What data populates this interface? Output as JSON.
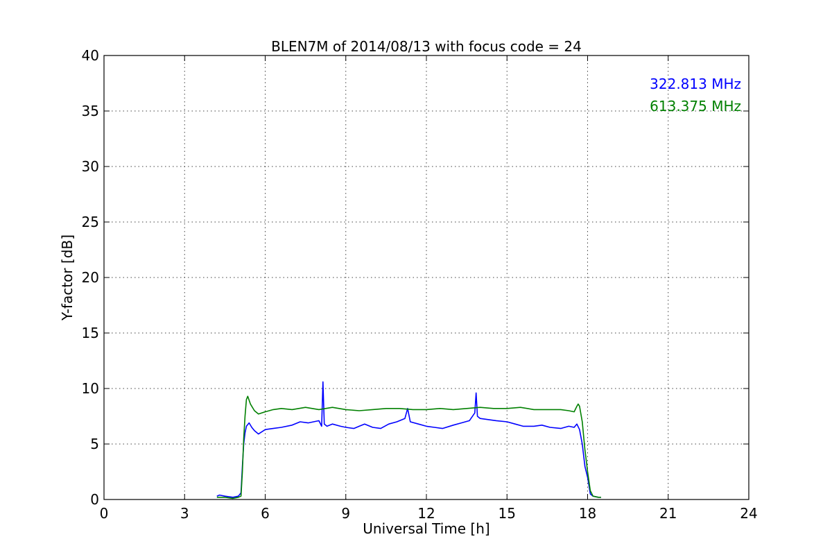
{
  "chart_data": {
    "type": "line",
    "title": "BLEN7M of 2014/08/13 with focus code = 24",
    "xlabel": "Universal Time [h]",
    "ylabel": "Y-factor [dB]",
    "xlim": [
      0,
      24
    ],
    "ylim": [
      0,
      40
    ],
    "xticks": [
      0,
      3,
      6,
      9,
      12,
      15,
      18,
      21,
      24
    ],
    "yticks": [
      0,
      5,
      10,
      15,
      20,
      25,
      30,
      35,
      40
    ],
    "grid": true,
    "legend_position": "top-right",
    "series": [
      {
        "name": "322.813 MHz",
        "color": "#0000ff",
        "x": [
          4.2,
          4.3,
          4.5,
          4.8,
          5.0,
          5.1,
          5.15,
          5.2,
          5.25,
          5.3,
          5.4,
          5.5,
          5.6,
          5.75,
          6.0,
          6.3,
          6.6,
          7.0,
          7.3,
          7.6,
          8.0,
          8.1,
          8.15,
          8.2,
          8.3,
          8.5,
          8.8,
          9.0,
          9.3,
          9.5,
          9.7,
          10.0,
          10.3,
          10.6,
          10.9,
          11.2,
          11.3,
          11.4,
          11.7,
          12.0,
          12.3,
          12.6,
          13.0,
          13.3,
          13.6,
          13.8,
          13.85,
          13.9,
          14.0,
          14.3,
          14.6,
          15.0,
          15.3,
          15.6,
          16.0,
          16.3,
          16.6,
          17.0,
          17.3,
          17.5,
          17.6,
          17.7,
          17.8,
          17.9,
          18.0,
          18.1,
          18.2,
          18.4,
          18.5
        ],
        "y": [
          0.3,
          0.4,
          0.3,
          0.2,
          0.3,
          0.6,
          3.0,
          5.0,
          6.0,
          6.6,
          6.9,
          6.5,
          6.2,
          5.9,
          6.3,
          6.4,
          6.5,
          6.7,
          7.0,
          6.9,
          7.1,
          6.6,
          10.6,
          6.8,
          6.6,
          6.8,
          6.6,
          6.5,
          6.4,
          6.6,
          6.8,
          6.5,
          6.4,
          6.8,
          7.0,
          7.3,
          8.2,
          7.0,
          6.8,
          6.6,
          6.5,
          6.4,
          6.7,
          6.9,
          7.1,
          7.8,
          9.6,
          7.5,
          7.3,
          7.2,
          7.1,
          7.0,
          6.8,
          6.6,
          6.6,
          6.7,
          6.5,
          6.4,
          6.6,
          6.5,
          6.8,
          6.3,
          5.0,
          3.0,
          2.0,
          0.5,
          0.3,
          0.2,
          0.2
        ]
      },
      {
        "name": "613.375 MHz",
        "color": "#008000",
        "x": [
          4.2,
          4.3,
          4.5,
          4.8,
          5.0,
          5.1,
          5.15,
          5.2,
          5.25,
          5.3,
          5.35,
          5.45,
          5.6,
          5.75,
          6.0,
          6.3,
          6.6,
          7.0,
          7.5,
          8.0,
          8.5,
          9.0,
          9.5,
          10.0,
          10.5,
          11.0,
          11.5,
          12.0,
          12.5,
          13.0,
          13.5,
          14.0,
          14.5,
          15.0,
          15.5,
          16.0,
          16.5,
          17.0,
          17.3,
          17.5,
          17.6,
          17.65,
          17.7,
          17.8,
          17.9,
          17.95,
          18.0,
          18.1,
          18.2,
          18.4,
          18.5
        ],
        "y": [
          0.2,
          0.2,
          0.2,
          0.1,
          0.2,
          0.3,
          2.5,
          5.5,
          7.5,
          9.0,
          9.3,
          8.6,
          8.0,
          7.7,
          7.9,
          8.1,
          8.2,
          8.1,
          8.3,
          8.1,
          8.3,
          8.1,
          8.0,
          8.1,
          8.2,
          8.2,
          8.1,
          8.1,
          8.2,
          8.1,
          8.2,
          8.3,
          8.2,
          8.2,
          8.3,
          8.1,
          8.1,
          8.1,
          8.0,
          7.9,
          8.4,
          8.6,
          8.4,
          7.0,
          4.5,
          3.5,
          2.5,
          0.8,
          0.3,
          0.2,
          0.2
        ]
      }
    ]
  }
}
